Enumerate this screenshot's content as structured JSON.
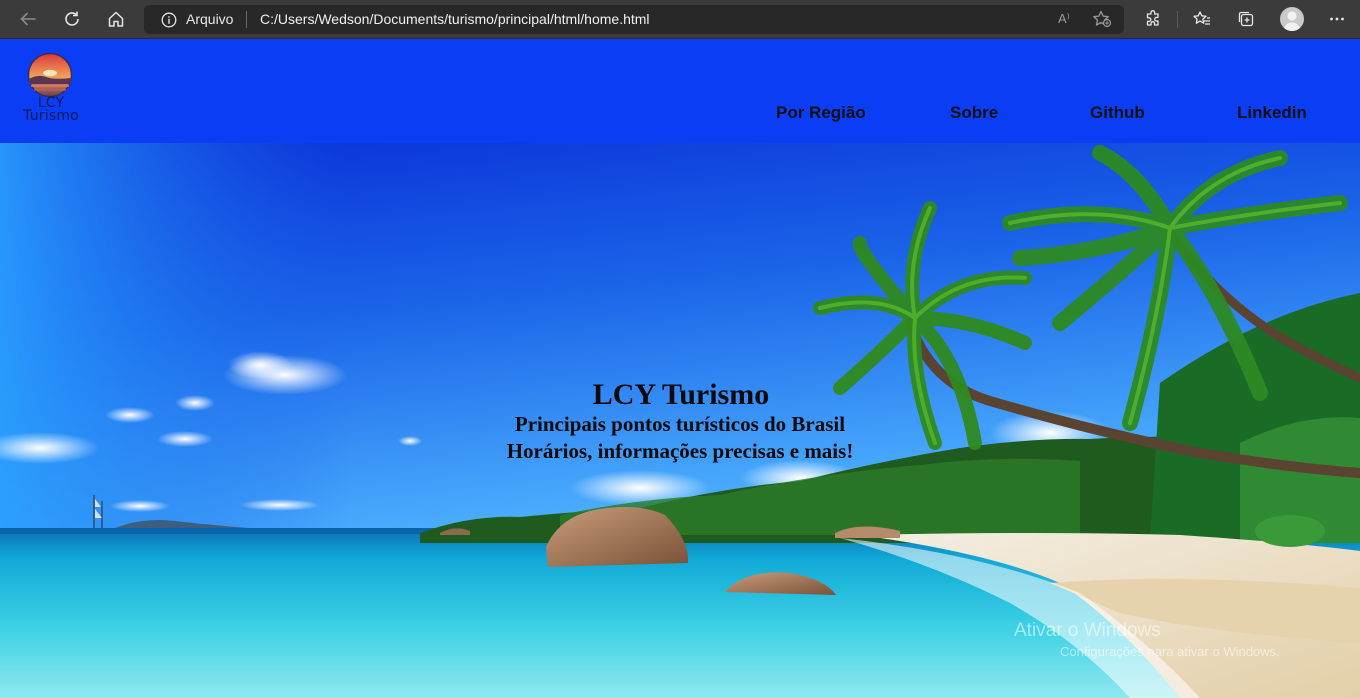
{
  "browser": {
    "scheme_label": "Arquivo",
    "url": "C:/Users/Wedson/Documents/turismo/principal/html/home.html",
    "icons": [
      "back-arrow-icon",
      "refresh-icon",
      "home-icon",
      "info-icon",
      "read-aloud-icon",
      "add-favorite-icon",
      "extensions-icon",
      "favorites-icon",
      "collections-icon",
      "profile-avatar",
      "more-icon"
    ],
    "read_aloud_glyph": "A⁾"
  },
  "site": {
    "logo_text_line1": "LCY",
    "logo_text_line2": "Turismo",
    "nav": [
      {
        "label": "Por Região"
      },
      {
        "label": "Sobre"
      },
      {
        "label": "Github"
      },
      {
        "label": "Linkedin"
      }
    ]
  },
  "hero": {
    "title": "LCY Turismo",
    "subtitle_line1": "Principais pontos turísticos do Brasil",
    "subtitle_line2": "Horários, informações precisas e mais!",
    "background": "tropical-beach-with-palm-trees"
  },
  "watermark": {
    "line1": "Ativar o Windows",
    "line2": "Configurações para ativar o Windows."
  },
  "colors": {
    "header_bg": "#0b3df5",
    "chrome_bg": "#3b3b3b",
    "address_bg": "#282828"
  }
}
